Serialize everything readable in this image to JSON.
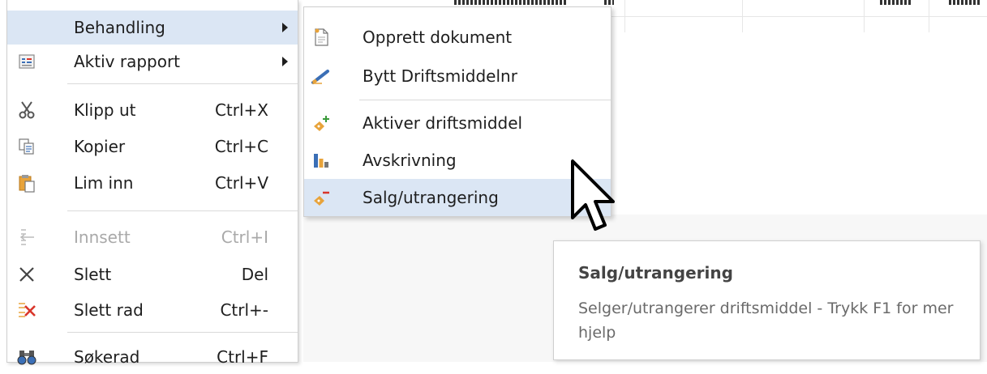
{
  "context_menu": {
    "items": [
      {
        "label": "Behandling",
        "shortcut": "",
        "icon": "none",
        "has_submenu": true,
        "hover": true,
        "disabled": false
      },
      {
        "label": "Aktiv rapport",
        "shortcut": "",
        "icon": "report-icon",
        "has_submenu": true,
        "hover": false,
        "disabled": false
      },
      {
        "label": "Klipp ut",
        "shortcut": "Ctrl+X",
        "icon": "scissors-icon",
        "has_submenu": false,
        "hover": false,
        "disabled": false
      },
      {
        "label": "Kopier",
        "shortcut": "Ctrl+C",
        "icon": "copy-icon",
        "has_submenu": false,
        "hover": false,
        "disabled": false
      },
      {
        "label": "Lim inn",
        "shortcut": "Ctrl+V",
        "icon": "paste-icon",
        "has_submenu": false,
        "hover": false,
        "disabled": false
      },
      {
        "label": "Innsett",
        "shortcut": "Ctrl+I",
        "icon": "insert-icon",
        "has_submenu": false,
        "hover": false,
        "disabled": true
      },
      {
        "label": "Slett",
        "shortcut": "Del",
        "icon": "delete-x-icon",
        "has_submenu": false,
        "hover": false,
        "disabled": false
      },
      {
        "label": "Slett rad",
        "shortcut": "Ctrl+-",
        "icon": "delete-row-icon",
        "has_submenu": false,
        "hover": false,
        "disabled": false
      },
      {
        "label": "Søkerad",
        "shortcut": "Ctrl+F",
        "icon": "binoculars-icon",
        "has_submenu": false,
        "hover": false,
        "disabled": false
      }
    ]
  },
  "sub_menu": {
    "items": [
      {
        "label": "Opprett dokument",
        "icon": "new-document-icon",
        "hover": false
      },
      {
        "label": "Bytt Driftsmiddelnr",
        "icon": "pencil-icon",
        "hover": false
      },
      {
        "label": "Aktiver driftsmiddel",
        "icon": "activate-asset-icon",
        "hover": false
      },
      {
        "label": "Avskrivning",
        "icon": "bar-chart-icon",
        "hover": false
      },
      {
        "label": "Salg/utrangering",
        "icon": "sell-asset-icon",
        "hover": true
      }
    ]
  },
  "tooltip": {
    "title": "Salg/utrangering",
    "body": "Selger/utrangerer driftsmiddel - Trykk F1 for mer hjelp"
  },
  "colors": {
    "hover_bg": "#dbe6f4",
    "disabled_text": "#a9a9a9",
    "icon_blue": "#3b6fb6",
    "icon_orange": "#e8a33a",
    "icon_red": "#d9362b",
    "icon_green": "#3a9a3a"
  }
}
